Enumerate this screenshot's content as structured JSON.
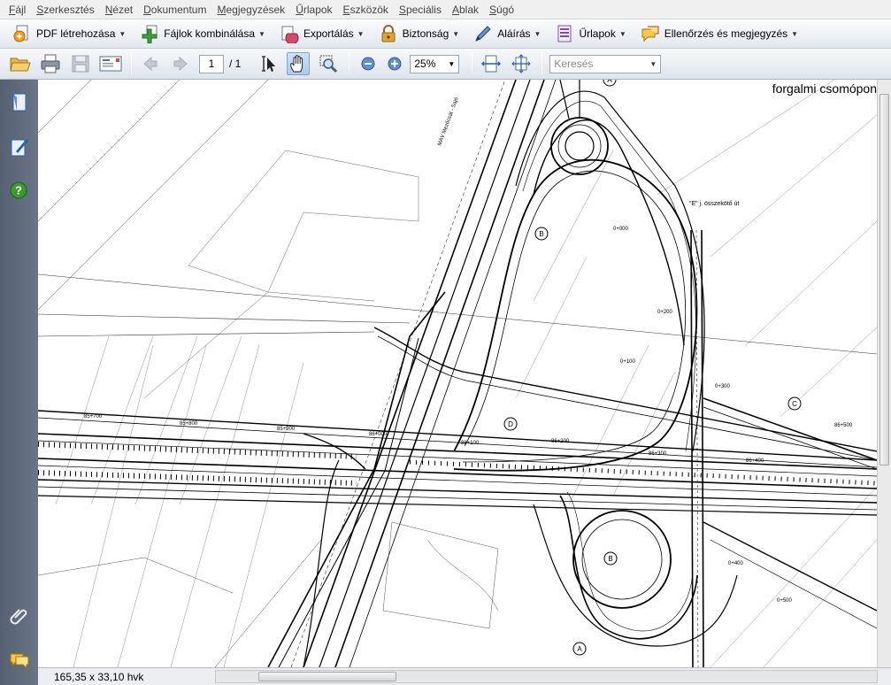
{
  "menu": [
    {
      "key": "F",
      "rest": "ájl"
    },
    {
      "key": "S",
      "rest": "zerkesztés"
    },
    {
      "key": "N",
      "rest": "ézet"
    },
    {
      "key": "D",
      "rest": "okumentum"
    },
    {
      "key": "M",
      "rest": "egjegyzések"
    },
    {
      "key": "Ű",
      "rest": "rlapok"
    },
    {
      "key": "E",
      "rest": "szközök"
    },
    {
      "key": "S",
      "rest": "peciális"
    },
    {
      "key": "A",
      "rest": "blak"
    },
    {
      "key": "S",
      "rest": "úgó"
    }
  ],
  "toolbar1": {
    "pdf_create": "PDF létrehozása",
    "combine": "Fájlok kombinálása",
    "export": "Exportálás",
    "security": "Biztonság",
    "sign": "Aláírás",
    "forms": "Űrlapok",
    "review": "Ellenőrzés és megjegyzés"
  },
  "toolbar2": {
    "page_current": "1",
    "page_total": "/ 1",
    "zoom": "25%",
    "search_placeholder": "Keresés"
  },
  "document": {
    "title_fragment": "forgalmi csomópon",
    "labels": {
      "rail": "MÁV Mezőcsát - Sajó",
      "road_e": "\"E\" j. összekötő út",
      "b1": "B",
      "b2": "B",
      "c": "C",
      "d": "D",
      "a1": "A",
      "a2": "A",
      "km1": "85+700",
      "km2": "85+800",
      "km3": "85+900",
      "km4": "86+000",
      "km5": "86+100",
      "km6": "86+200",
      "km7": "86+300",
      "km8": "86+400",
      "km9": "86+500",
      "km10": "0+000",
      "km11": "0+100",
      "km12": "0+200",
      "km13": "0+300",
      "km14": "0+400",
      "km15": "0+500"
    }
  },
  "status": {
    "dimensions": "165,35 x 33,10 hvk"
  },
  "colors": {
    "accent_blue": "#2a5fb0",
    "nav_bg": "#5f6a7a",
    "green_help": "#3a9a2a"
  }
}
